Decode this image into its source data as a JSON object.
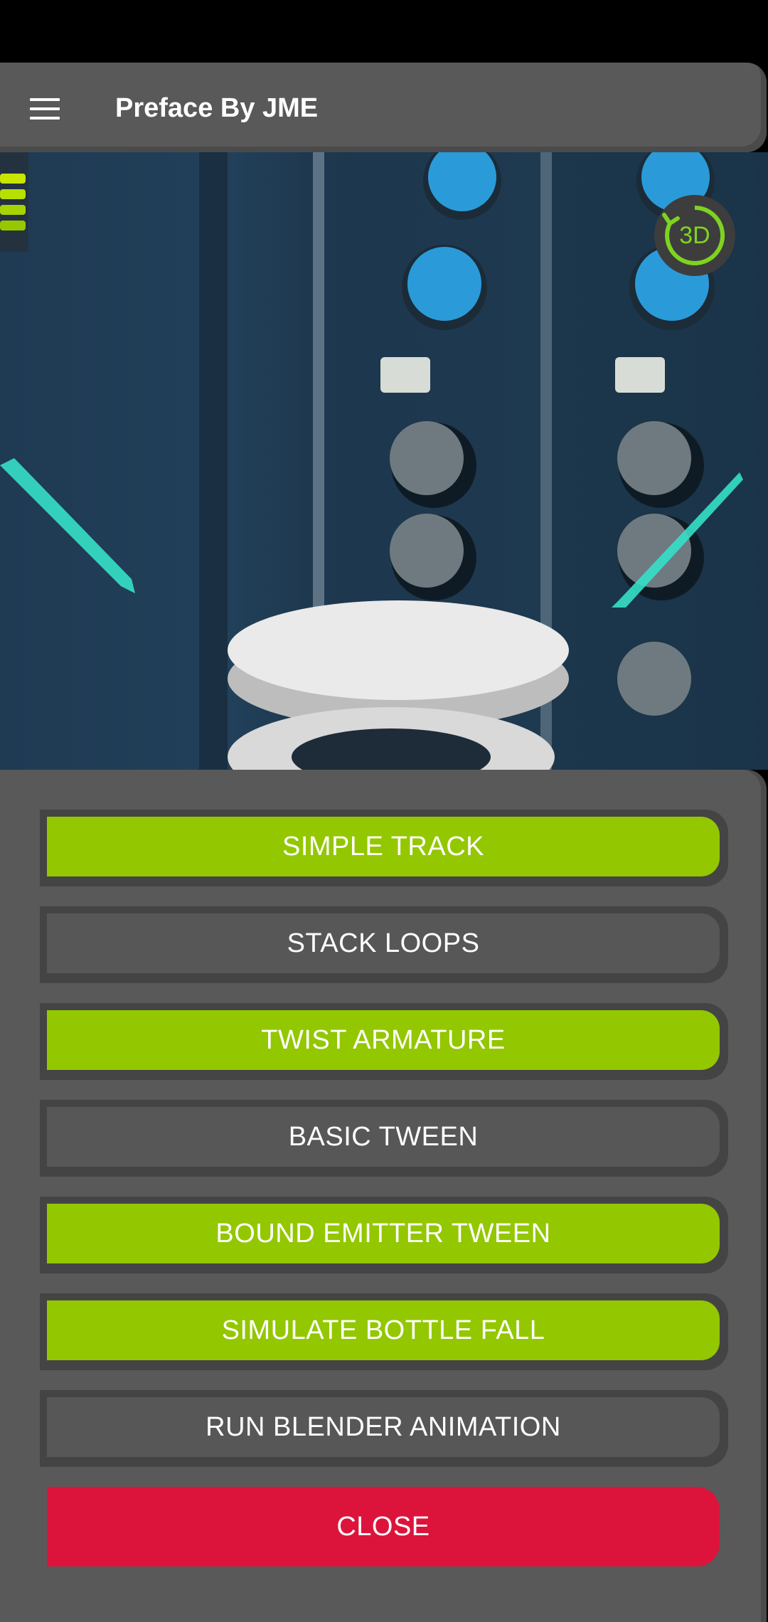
{
  "app": {
    "title": "Preface By JME"
  },
  "toolbar": {
    "menu_icon": "hamburger-menu-icon"
  },
  "scene": {
    "badge_label": "3D",
    "badge_icon": "rotate-3d-icon",
    "accent_color": "#7ed321"
  },
  "panel": {
    "buttons": [
      {
        "label": "SIMPLE TRACK",
        "style": "green"
      },
      {
        "label": "STACK LOOPS",
        "style": "grey"
      },
      {
        "label": "TWIST ARMATURE",
        "style": "green"
      },
      {
        "label": "BASIC TWEEN",
        "style": "grey"
      },
      {
        "label": "BOUND EMITTER TWEEN",
        "style": "green"
      },
      {
        "label": "SIMULATE BOTTLE FALL",
        "style": "green"
      },
      {
        "label": "RUN BLENDER ANIMATION",
        "style": "grey"
      }
    ],
    "close_label": "CLOSE"
  },
  "colors": {
    "green": "#93c700",
    "grey": "#575757",
    "close": "#dc143c",
    "panel": "#595959"
  }
}
